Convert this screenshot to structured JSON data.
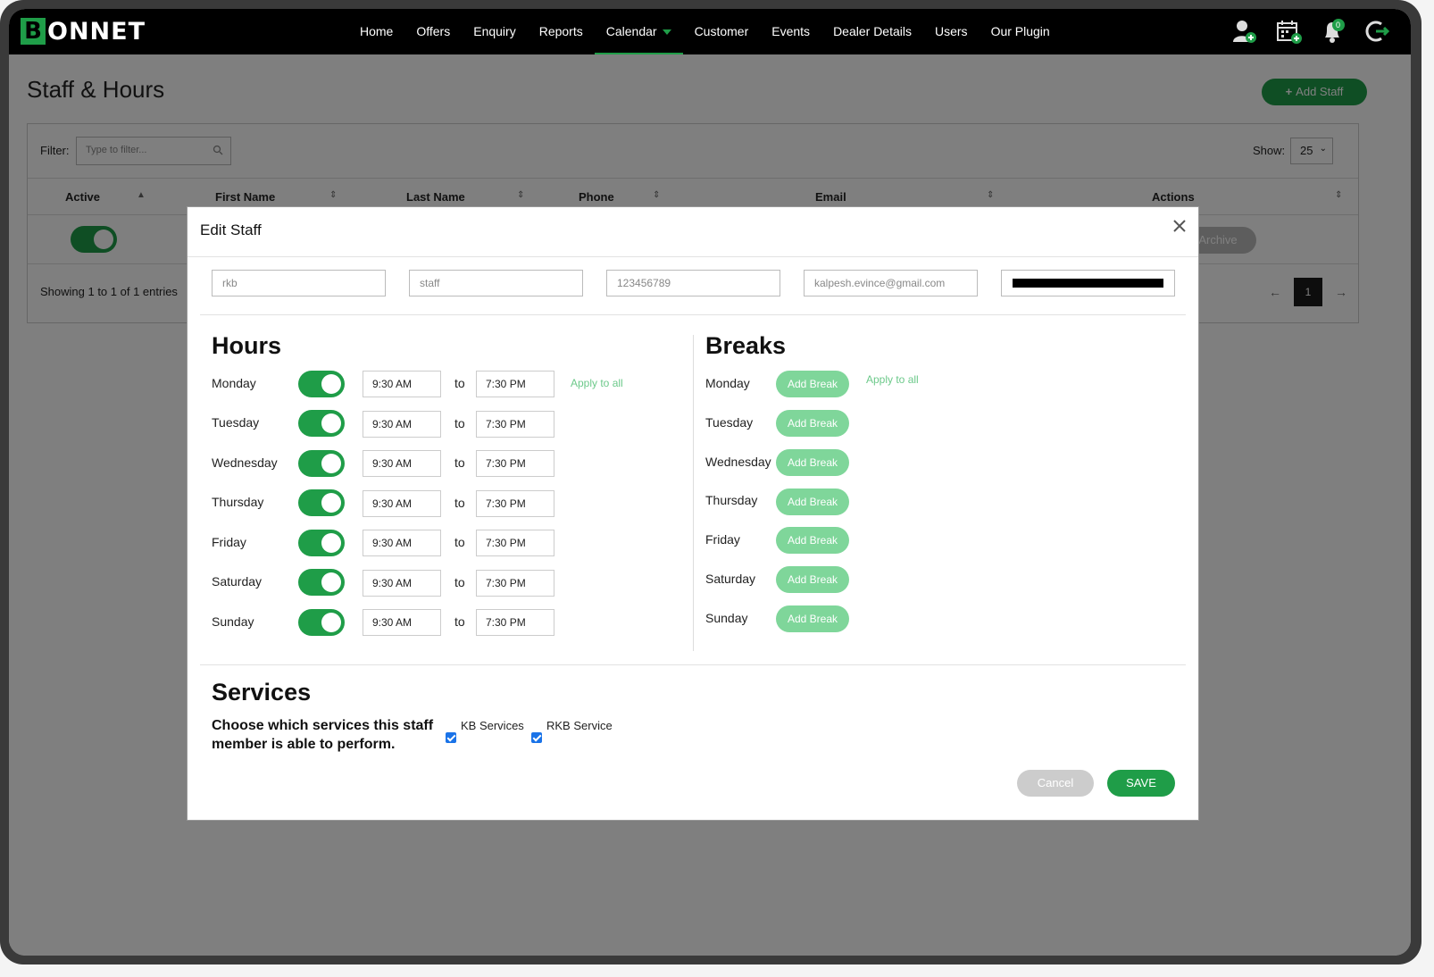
{
  "app": {
    "logo_initial": "B",
    "logo_rest": "ONNET",
    "nav": [
      "Home",
      "Offers",
      "Enquiry",
      "Reports",
      "Calendar",
      "Customer",
      "Events",
      "Dealer Details",
      "Users",
      "Our Plugin"
    ],
    "notification_count": "0"
  },
  "page": {
    "title": "Staff & Hours",
    "add_staff": "Add Staff",
    "filter_label": "Filter:",
    "filter_placeholder": "Type to filter...",
    "show_label": "Show:",
    "show_value": "25",
    "columns": [
      "Active",
      "First Name",
      "Last Name",
      "Phone",
      "Email",
      "Actions"
    ],
    "archive": "Archive",
    "showing": "Showing 1 to 1 of 1 entries",
    "page_number": "1",
    "prev": "←",
    "next": "→"
  },
  "modal": {
    "title": "Edit Staff",
    "fields": {
      "first_name": "rkb",
      "last_name": "staff",
      "phone": "123456789",
      "email": "kalpesh.evince@gmail.com"
    },
    "hours_title": "Hours",
    "breaks_title": "Breaks",
    "to_label": "to",
    "apply_to_all": "Apply to all",
    "add_break": "Add Break",
    "days": [
      {
        "name": "Monday",
        "start": "9:30 AM",
        "end": "7:30 PM"
      },
      {
        "name": "Tuesday",
        "start": "9:30 AM",
        "end": "7:30 PM"
      },
      {
        "name": "Wednesday",
        "start": "9:30 AM",
        "end": "7:30 PM"
      },
      {
        "name": "Thursday",
        "start": "9:30 AM",
        "end": "7:30 PM"
      },
      {
        "name": "Friday",
        "start": "9:30 AM",
        "end": "7:30 PM"
      },
      {
        "name": "Saturday",
        "start": "9:30 AM",
        "end": "7:30 PM"
      },
      {
        "name": "Sunday",
        "start": "9:30 AM",
        "end": "7:30 PM"
      }
    ],
    "services_title": "Services",
    "services_subtitle": "Choose which services this staff member is able to perform.",
    "services": [
      {
        "name": "KB Services",
        "checked": true
      },
      {
        "name": "RKB Service",
        "checked": true
      }
    ],
    "cancel": "Cancel",
    "save": "SAVE"
  },
  "colors": {
    "brand_green": "#1f9d48",
    "light_green": "#7fd69a",
    "checkbox_blue": "#1a73e8"
  }
}
